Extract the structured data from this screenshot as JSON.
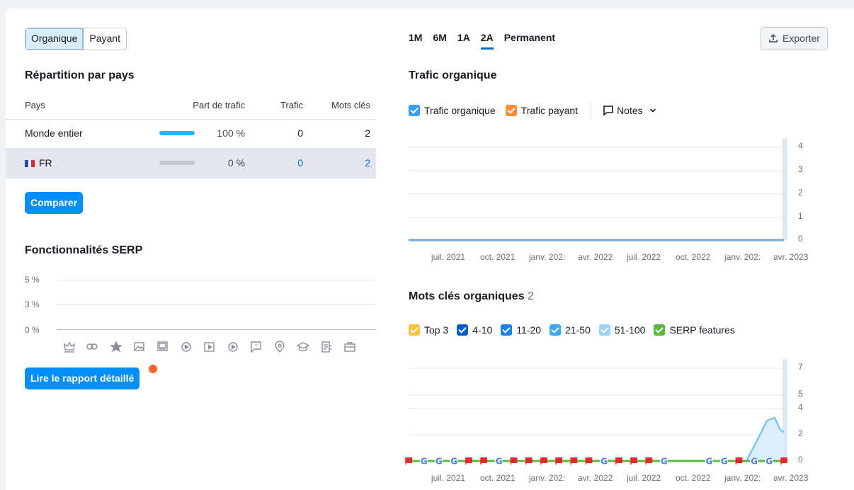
{
  "tabs": {
    "organic": "Organique",
    "paid": "Payant"
  },
  "countries": {
    "title": "Répartition par pays",
    "headers": [
      "Pays",
      "Part de trafic",
      "Trafic",
      "Mots clés"
    ],
    "rows": [
      {
        "country": "Monde entier",
        "share": "100 %",
        "share_value": 100,
        "traffic": "0",
        "keywords": "2"
      },
      {
        "country": "FR",
        "share": "0 %",
        "share_value": 0,
        "traffic": "0",
        "keywords": "2"
      }
    ],
    "compare": "Comparer"
  },
  "serp": {
    "title": "Fonctionnalités SERP",
    "yticks": [
      "5 %",
      "3 %",
      "0 %"
    ],
    "icons": [
      "crown-icon",
      "link-icon",
      "star-icon",
      "image-icon",
      "image-pack-icon",
      "video-icon",
      "video-carousel-icon",
      "play-icon",
      "faq-icon",
      "location-icon",
      "graduation-icon",
      "document-icon",
      "briefcase-icon"
    ],
    "report_button": "Lire le rapport détaillé"
  },
  "periods": [
    "1M",
    "6M",
    "1A",
    "2A",
    "Permanent"
  ],
  "selected_period": "2A",
  "export_label": "Exporter",
  "traffic_chart": {
    "title": "Trafic organique",
    "legend": [
      {
        "label": "Trafic organique",
        "color": "#3c9ef2"
      },
      {
        "label": "Trafic payant",
        "color": "#ff8c37"
      }
    ],
    "notes": "Notes"
  },
  "keywords_chart": {
    "title": "Mots clés organiques",
    "count": "2",
    "legend": [
      {
        "label": "Top 3",
        "color": "#ffc340"
      },
      {
        "label": "4-10",
        "color": "#0b5ec9"
      },
      {
        "label": "11-20",
        "color": "#1b82e6"
      },
      {
        "label": "21-50",
        "color": "#39a9f5"
      },
      {
        "label": "51-100",
        "color": "#9dd3fb"
      },
      {
        "label": "SERP features",
        "color": "#5ab83c"
      }
    ]
  },
  "chart_data": [
    {
      "type": "line",
      "title": "Trafic organique",
      "x": [
        "juil. 2021",
        "oct. 2021",
        "janv. 2022",
        "avr. 2022",
        "juil. 2022",
        "oct. 2022",
        "janv. 2023",
        "avr. 2023"
      ],
      "x_labels": [
        "juil. 2021",
        "oct. 2021",
        "janv. 202:",
        "avr. 2022",
        "juil. 2022",
        "oct. 2022",
        "janv. 202:",
        "avr. 2023"
      ],
      "yticks": [
        "4",
        "3",
        "2",
        "1",
        "0"
      ],
      "ylim": [
        0,
        4
      ],
      "series": [
        {
          "name": "Trafic organique",
          "values": [
            0,
            0,
            0,
            0,
            0,
            0,
            0,
            0
          ]
        }
      ],
      "grid": true
    },
    {
      "type": "area",
      "title": "Mots clés organiques",
      "x_labels": [
        "juil. 2021",
        "oct. 2021",
        "janv. 202:",
        "avr. 2022",
        "juil. 2022",
        "oct. 2022",
        "janv. 202:",
        "avr. 2023"
      ],
      "yticks": [
        "7",
        "5",
        "4",
        "2",
        "0"
      ],
      "ylim": [
        0,
        7
      ],
      "series": [
        {
          "name": "51-100",
          "x": [
            0,
            0.9,
            0.93,
            0.955,
            0.975,
            0.99,
            1.0
          ],
          "values": [
            0,
            0,
            1.5,
            2.8,
            3.0,
            2.2,
            2.0
          ]
        }
      ],
      "markers": [
        "flag",
        "G",
        "G",
        "G",
        "flag",
        "flag",
        "G",
        "flag",
        "flag",
        "flag",
        "flag",
        "flag",
        "flag",
        "G",
        "flag",
        "flag",
        "flag",
        "G",
        "",
        "",
        "G",
        "G",
        "flag",
        "G",
        "G",
        "flag"
      ],
      "grid": true
    }
  ]
}
